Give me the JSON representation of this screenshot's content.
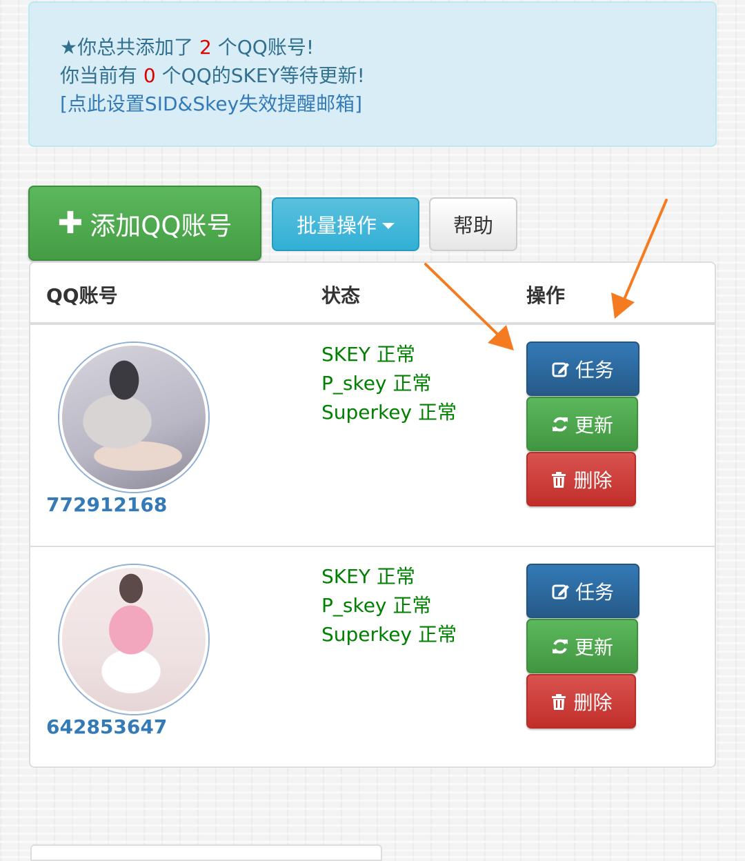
{
  "notice": {
    "line1_prefix": "★你总共添加了",
    "account_count": "2",
    "line1_suffix": "个QQ账号!",
    "line2_prefix": "你当前有",
    "pending_count": "0",
    "line2_suffix": "个QQ的SKEY等待更新!",
    "settings_link": "[点此设置SID&Skey失效提醒邮箱]"
  },
  "toolbar": {
    "add_label": "添加QQ账号",
    "batch_label": "批量操作",
    "help_label": "帮助"
  },
  "table": {
    "headers": [
      "QQ账号",
      "状态",
      "操作"
    ],
    "rows": [
      {
        "qq": "772912168",
        "status": [
          "SKEY 正常",
          "P_skey 正常",
          "Superkey 正常"
        ],
        "actions": [
          "任务",
          "更新",
          "删除"
        ]
      },
      {
        "qq": "642853647",
        "status": [
          "SKEY 正常",
          "P_skey 正常",
          "Superkey 正常"
        ],
        "actions": [
          "任务",
          "更新",
          "删除"
        ]
      }
    ]
  },
  "colors": {
    "status_ok": "#008000",
    "count_highlight": "#e00000",
    "annotation_arrow": "#f47b20"
  },
  "icons": {
    "add": "plus-icon",
    "batch": "caret-down-icon",
    "task": "edit-icon",
    "update": "refresh-icon",
    "delete": "trash-icon"
  }
}
